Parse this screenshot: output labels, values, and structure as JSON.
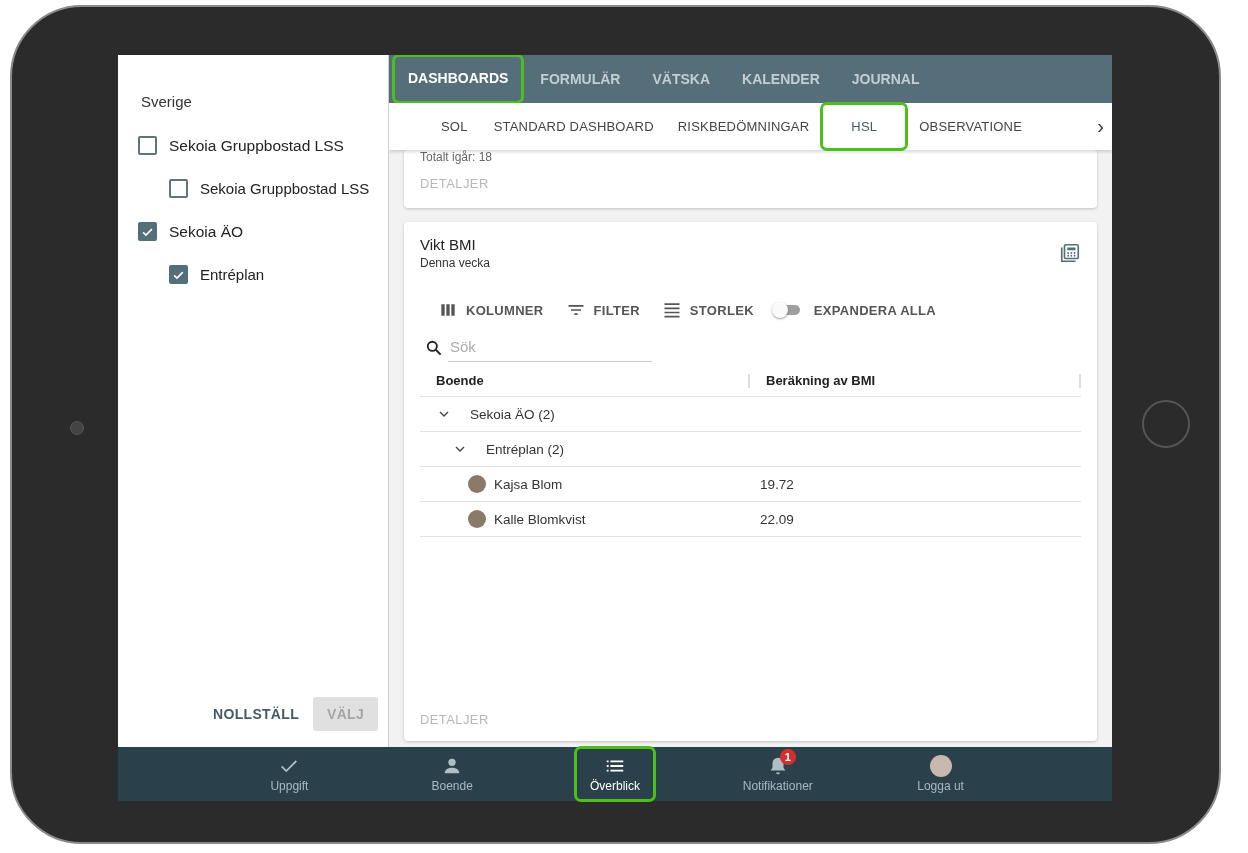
{
  "sidebar": {
    "heading": "Sverige",
    "items": [
      {
        "label": "Sekoia Gruppbostad LSS",
        "checked": false,
        "children": [
          {
            "label": "Sekoia Gruppbostad LSS",
            "checked": false
          }
        ]
      },
      {
        "label": "Sekoia ÄO",
        "checked": true,
        "children": [
          {
            "label": "Entréplan",
            "checked": true
          }
        ]
      }
    ],
    "buttons": [
      {
        "label": "NOLLSTÄLL",
        "disabled": false
      },
      {
        "label": "VÄLJ",
        "disabled": true
      }
    ]
  },
  "main_tabs": [
    {
      "label": "DASHBOARDS",
      "selected": true,
      "highlighted": true
    },
    {
      "label": "FORMULÄR",
      "selected": false,
      "highlighted": false
    },
    {
      "label": "VÄTSKA",
      "selected": false,
      "highlighted": false
    },
    {
      "label": "KALENDER",
      "selected": false,
      "highlighted": false
    },
    {
      "label": "JOURNAL",
      "selected": false,
      "highlighted": false
    }
  ],
  "sub_tabs": {
    "items": [
      {
        "label": "SOL",
        "selected": false,
        "highlighted": false
      },
      {
        "label": "STANDARD DASHBOARD",
        "selected": false,
        "highlighted": false
      },
      {
        "label": "RISKBEDÖMNINGAR",
        "selected": false,
        "highlighted": false
      },
      {
        "label": "HSL",
        "selected": true,
        "highlighted": true
      },
      {
        "label": "OBSERVATIONE",
        "selected": false,
        "highlighted": false
      }
    ],
    "scroll": "›"
  },
  "cards": [
    {
      "kind": "partial",
      "text": "Totalt igår: 18",
      "link": "DETALJER"
    },
    {
      "kind": "table",
      "title": "Vikt BMI",
      "subtitle": "Denna vecka",
      "toolbar": [
        {
          "label": "KOLUMNER",
          "kind": "columns"
        },
        {
          "label": "FILTER",
          "kind": "filter"
        },
        {
          "label": "STORLEK",
          "kind": "density"
        },
        {
          "label": "EXPANDERA ALLA",
          "kind": "toggle",
          "on": false
        }
      ],
      "search": {
        "placeholder": "Sök"
      },
      "columns": [
        "Boende",
        "Beräkning av BMI"
      ],
      "rows": [
        {
          "kind": "group",
          "label": "Sekoia ÄO (2)",
          "expanded": true,
          "children": [
            {
              "kind": "group",
              "label": "Entréplan (2)",
              "expanded": true,
              "children": [
                {
                  "kind": "person",
                  "name": "Kajsa Blom",
                  "value": "19.72"
                },
                {
                  "kind": "person",
                  "name": "Kalle Blomkvist",
                  "value": "22.09"
                }
              ]
            }
          ]
        }
      ],
      "link": "DETALJER"
    }
  ],
  "bottom_nav": [
    {
      "label": "Uppgift",
      "selected": false,
      "highlighted": false
    },
    {
      "label": "Boende",
      "selected": false,
      "highlighted": false
    },
    {
      "label": "Överblick",
      "selected": true,
      "highlighted": true
    },
    {
      "label": "Notifikationer",
      "selected": false,
      "highlighted": false,
      "badge": "1"
    },
    {
      "label": "Logga ut",
      "selected": false,
      "highlighted": false
    }
  ]
}
